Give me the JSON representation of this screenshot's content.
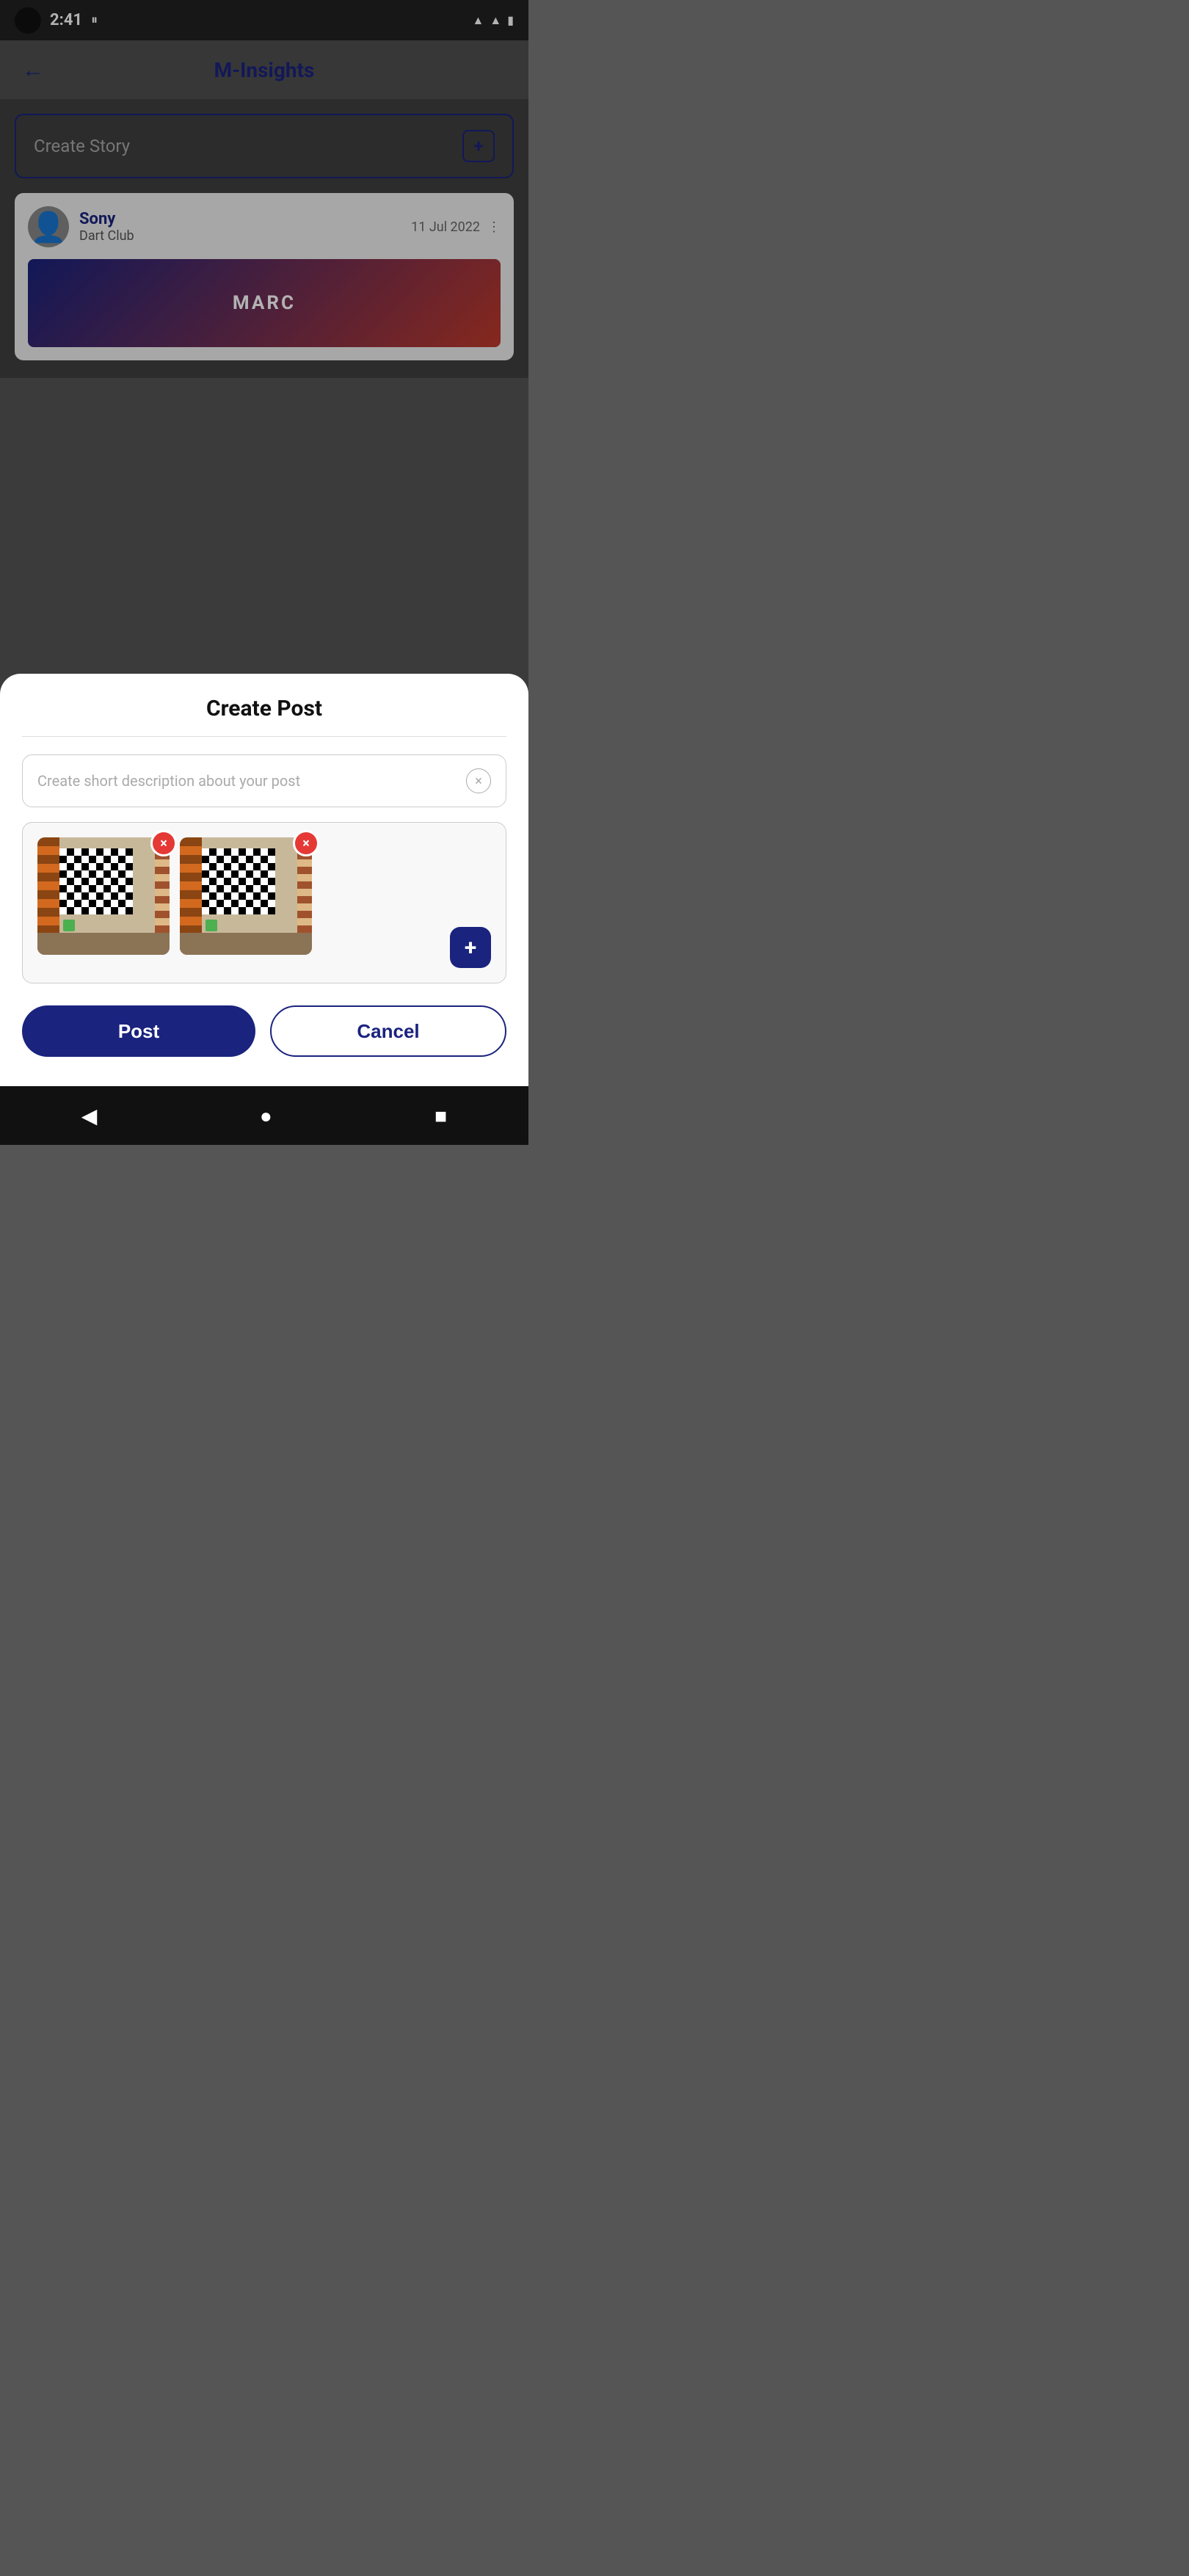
{
  "statusBar": {
    "time": "2:41",
    "icons": [
      "wifi",
      "signal",
      "battery"
    ]
  },
  "header": {
    "title": "M-Insights",
    "backLabel": "←"
  },
  "backgroundContent": {
    "createStory": {
      "placeholder": "Create Story",
      "addBtnLabel": "+"
    },
    "postCard": {
      "userName": "Sony",
      "userSubtitle": "Dart Club",
      "date": "11 Jul 2022",
      "menuIcon": "⋮",
      "brandText": "MARC"
    }
  },
  "modal": {
    "title": "Create Post",
    "descriptionPlaceholder": "Create short description about your post",
    "clearIconLabel": "×",
    "addImageLabel": "+",
    "images": [
      {
        "id": 1,
        "alt": "Chess board in room - image 1"
      },
      {
        "id": 2,
        "alt": "Chess board in room - image 2"
      }
    ],
    "removeIconLabel": "×",
    "buttons": {
      "post": "Post",
      "cancel": "Cancel"
    }
  },
  "bottomNav": {
    "back": "◀",
    "home": "●",
    "recent": "■"
  },
  "colors": {
    "primaryBlue": "#1a237e",
    "removeRed": "#e53935",
    "greenDot": "#4caf50",
    "textGray": "#888",
    "borderGray": "#ccc"
  }
}
